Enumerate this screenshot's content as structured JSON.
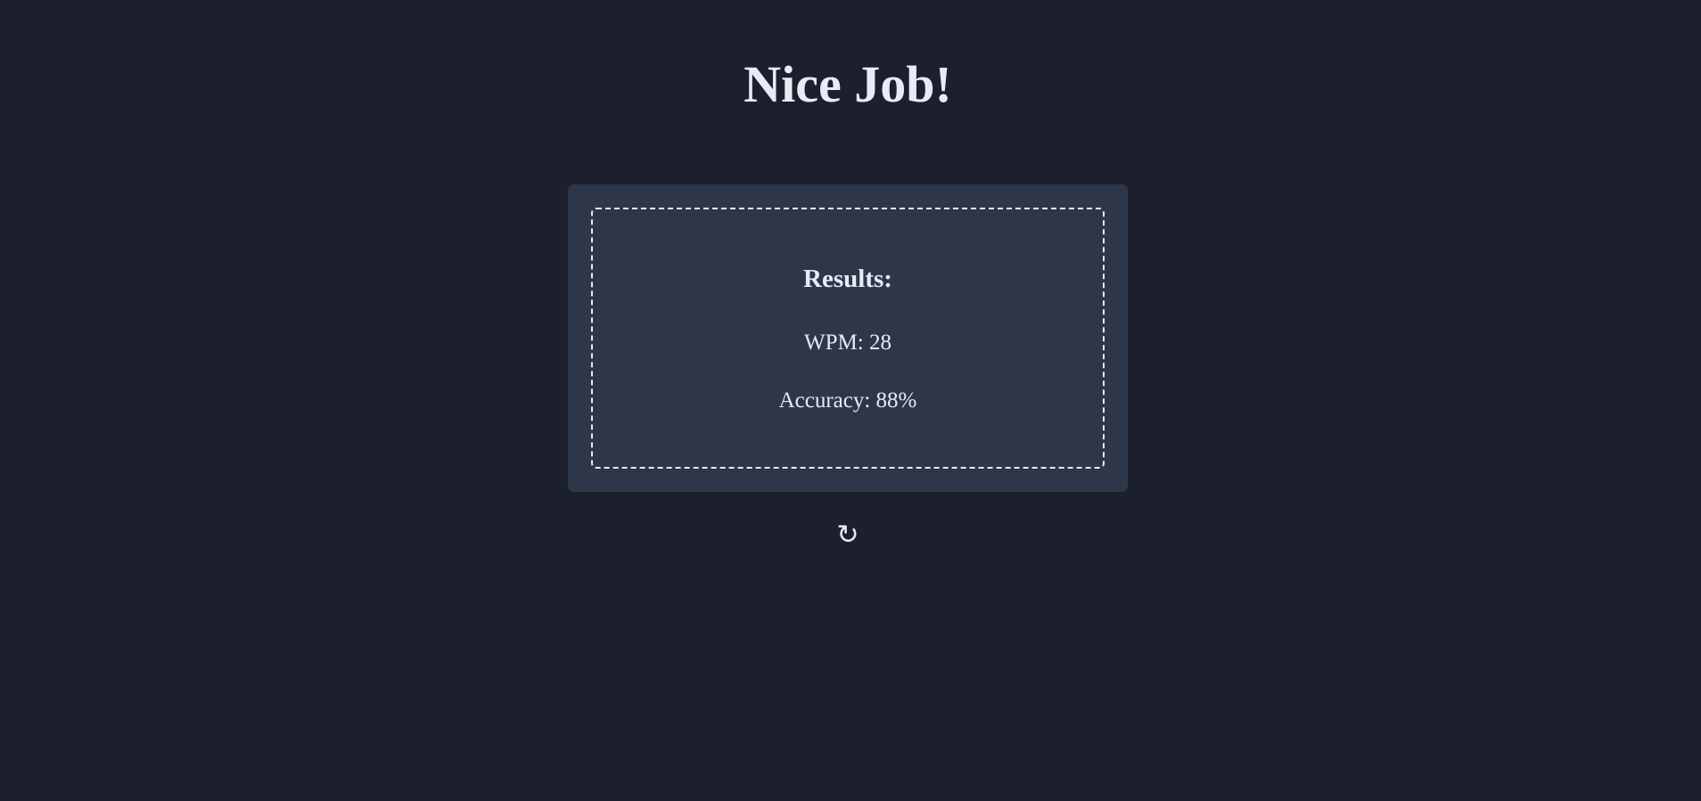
{
  "header": {
    "title": "Nice Job!"
  },
  "results": {
    "heading": "Results:",
    "wpm": {
      "label": "WPM:",
      "value": 28,
      "text": "WPM: 28"
    },
    "accuracy": {
      "label": "Accuracy:",
      "value_percent": 88,
      "text": "Accuracy: 88%"
    }
  },
  "controls": {
    "restart": {
      "glyph": "↻",
      "icon": "restart-icon"
    }
  },
  "colors": {
    "background": "#1b202c",
    "card": "#2e3749",
    "text": "#e6ebf5"
  }
}
